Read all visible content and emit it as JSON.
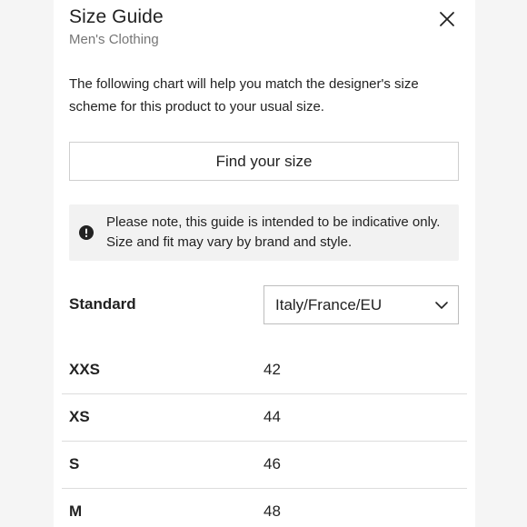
{
  "header": {
    "title": "Size Guide",
    "subtitle": "Men's Clothing",
    "close_icon": "close-icon"
  },
  "intro": "The following chart will help you match the designer's size scheme for this product to your usual size.",
  "find_size_button": "Find your size",
  "notice": {
    "icon": "exclamation-circle-icon",
    "text": "Please note, this guide is intended to be indicative only. Size and fit may vary by brand and style."
  },
  "standard": {
    "label": "Standard",
    "selected": "Italy/France/EU",
    "icon": "chevron-down-icon"
  },
  "sizes": [
    {
      "name": "XXS",
      "value": "42"
    },
    {
      "name": "XS",
      "value": "44"
    },
    {
      "name": "S",
      "value": "46"
    },
    {
      "name": "M",
      "value": "48"
    }
  ],
  "colors": {
    "text": "#222222",
    "muted": "#767676",
    "border": "#cfcfcf",
    "notice_bg": "#f2f2f2",
    "backdrop": "#f5f5f5"
  }
}
